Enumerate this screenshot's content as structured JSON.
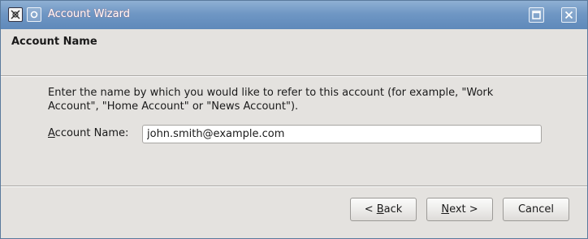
{
  "window": {
    "title": "Account Wizard",
    "title_accent_color": "#6f97c4"
  },
  "page": {
    "heading": "Account Name",
    "description_line1": "Enter the name by which you would like to refer to this account (for example, \"Work",
    "description_line2": "Account\", \"Home Account\" or \"News Account\")."
  },
  "form": {
    "account_name_mnemonic": "A",
    "account_name_label_rest": "ccount Name:",
    "account_name_value": "john.smith@example.com"
  },
  "buttons": {
    "back_prefix": "< ",
    "back_mnemonic": "B",
    "back_rest": "ack",
    "next_mnemonic": "N",
    "next_rest": "ext >",
    "cancel": "Cancel"
  },
  "icons": {
    "app": "app-icon",
    "window_menu": "window-menu-icon",
    "maximize": "maximize-icon",
    "close": "close-icon"
  }
}
